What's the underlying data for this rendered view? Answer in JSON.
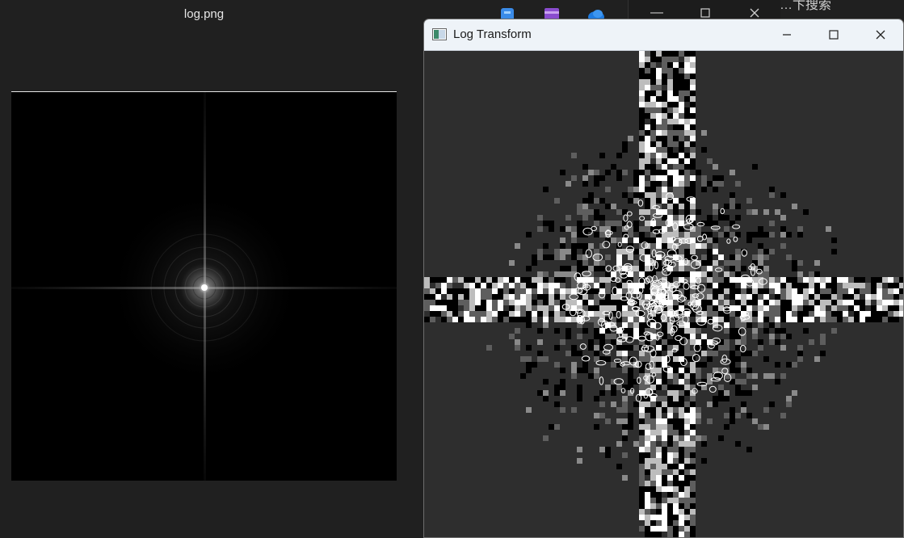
{
  "viewer": {
    "title": "log.png"
  },
  "background_window": {
    "partial_text": "…卞搜索"
  },
  "log_window": {
    "title": "Log Transform",
    "controls": {
      "minimize": "minimize",
      "maximize": "maximize",
      "close": "close"
    }
  },
  "icons": [
    "image-app-icon",
    "minimize-icon",
    "maximize-icon",
    "close-icon"
  ],
  "colors": {
    "desktop": "#202020",
    "titlebar": "#eef3f8",
    "client": "#2e2e2e",
    "taskbar_blue": "#3a8be8",
    "taskbar_purple": "#8a4ccf",
    "taskbar_sky": "#1e7be0"
  }
}
